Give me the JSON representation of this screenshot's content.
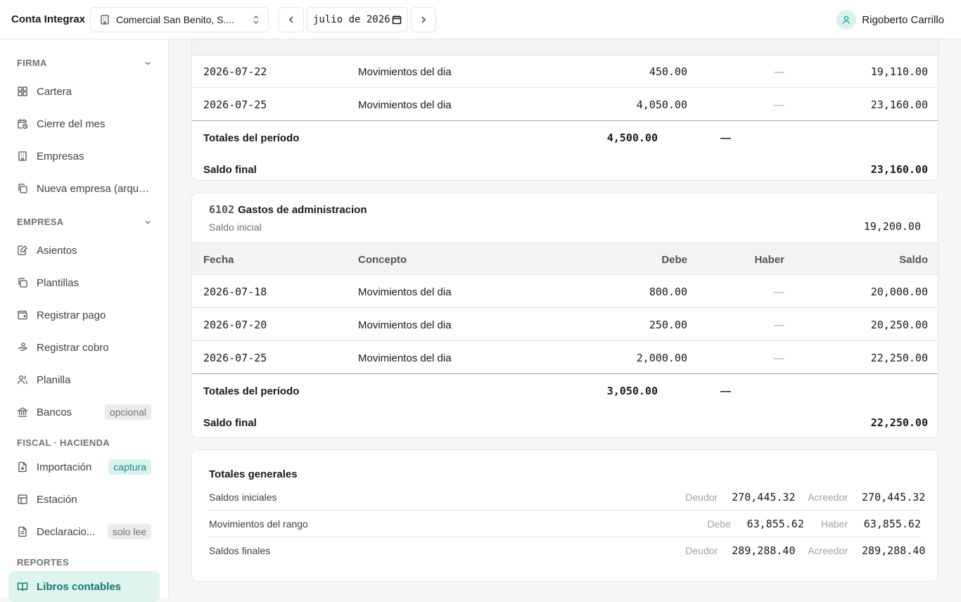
{
  "app": {
    "title": "Conta Integrax"
  },
  "header": {
    "company": "Comercial San Benito, S....",
    "period_value": "julio de 2026",
    "user_name": "Rigoberto Carrillo"
  },
  "sidebar": {
    "sections": [
      {
        "title": "FIRMA"
      },
      {
        "title": "EMPRESA"
      },
      {
        "title": "FISCAL · HACIENDA"
      },
      {
        "title": "REPORTES"
      }
    ],
    "items": [
      {
        "label": "Cartera",
        "icon": "grid-icon"
      },
      {
        "label": "Cierre del mes",
        "icon": "calendar-clock-icon"
      },
      {
        "label": "Empresas",
        "icon": "building-icon"
      },
      {
        "label": "Nueva empresa (arque...",
        "icon": "copy-icon"
      },
      {
        "label": "Asientos",
        "icon": "notebook-pen-icon"
      },
      {
        "label": "Plantillas",
        "icon": "copy-icon"
      },
      {
        "label": "Registrar pago",
        "icon": "wallet-icon"
      },
      {
        "label": "Registrar cobro",
        "icon": "hand-coins-icon"
      },
      {
        "label": "Planilla",
        "icon": "users-icon"
      },
      {
        "label": "Bancos",
        "icon": "bank-icon",
        "badge": "opcional"
      },
      {
        "label": "Importación",
        "icon": "file-import-icon",
        "badge": "captura"
      },
      {
        "label": "Estación",
        "icon": "table-icon"
      },
      {
        "label": "Declaracio...",
        "icon": "file-text-icon",
        "badge": "solo lee"
      },
      {
        "label": "Libros contables",
        "icon": "book-open-icon"
      }
    ]
  },
  "columns": {
    "fecha": "Fecha",
    "concepto": "Concepto",
    "debe": "Debe",
    "haber": "Haber",
    "saldo": "Saldo"
  },
  "account_prev": {
    "rows": [
      {
        "fecha": "2026-07-22",
        "concepto": "Movimientos del dia",
        "debe": "450.00",
        "haber": "—",
        "saldo": "19,110.00"
      },
      {
        "fecha": "2026-07-25",
        "concepto": "Movimientos del dia",
        "debe": "4,050.00",
        "haber": "—",
        "saldo": "23,160.00"
      }
    ],
    "totals_label": "Totales del período",
    "totals_debe": "4,500.00",
    "totals_haber": "—",
    "final_label": "Saldo final",
    "final_value": "23,160.00"
  },
  "account_6102": {
    "code": "6102",
    "name": "Gastos de administracion",
    "opening_label": "Saldo inicial",
    "opening_value": "19,200.00",
    "rows": [
      {
        "fecha": "2026-07-18",
        "concepto": "Movimientos del dia",
        "debe": "800.00",
        "haber": "—",
        "saldo": "20,000.00"
      },
      {
        "fecha": "2026-07-20",
        "concepto": "Movimientos del dia",
        "debe": "250.00",
        "haber": "—",
        "saldo": "20,250.00"
      },
      {
        "fecha": "2026-07-25",
        "concepto": "Movimientos del dia",
        "debe": "2,000.00",
        "haber": "—",
        "saldo": "22,250.00"
      }
    ],
    "totals_label": "Totales del período",
    "totals_debe": "3,050.00",
    "totals_haber": "—",
    "final_label": "Saldo final",
    "final_value": "22,250.00"
  },
  "general_totals": {
    "title": "Totales generales",
    "rows": [
      {
        "label": "Saldos iniciales",
        "k1": "Deudor",
        "v1": "270,445.32",
        "k2": "Acreedor",
        "v2": "270,445.32"
      },
      {
        "label": "Movimientos del rango",
        "k1": "Debe",
        "v1": "63,855.62",
        "k2": "Haber",
        "v2": "63,855.62"
      },
      {
        "label": "Saldos finales",
        "k1": "Deudor",
        "v1": "289,288.40",
        "k2": "Acreedor",
        "v2": "289,288.40"
      }
    ]
  }
}
